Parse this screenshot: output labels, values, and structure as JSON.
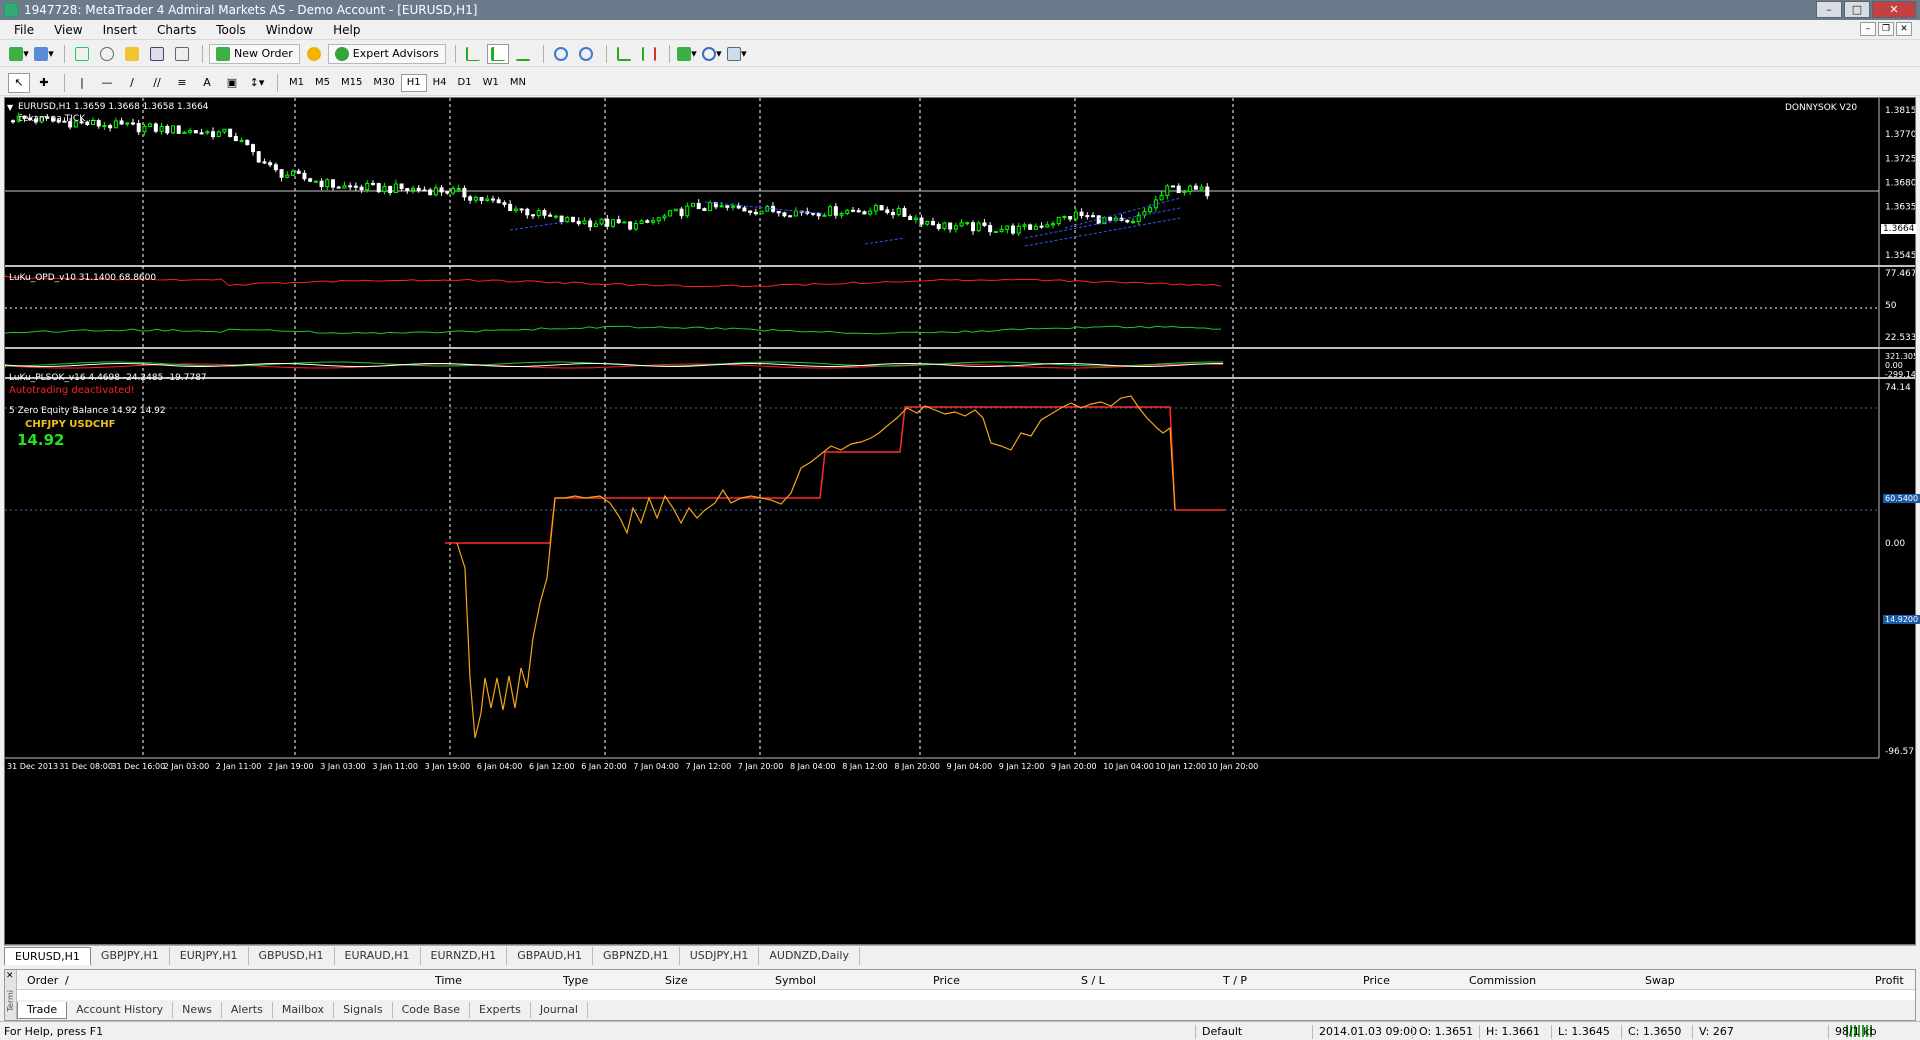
{
  "window": {
    "title": "1947728: MetaTrader 4 Admiral Markets AS - Demo Account - [EURUSD,H1]"
  },
  "menu": [
    "File",
    "View",
    "Insert",
    "Charts",
    "Tools",
    "Window",
    "Help"
  ],
  "toolbar": {
    "new_order": "New Order",
    "expert_advisors": "Expert Advisors",
    "timeframes": [
      "M1",
      "M5",
      "M15",
      "M30",
      "H1",
      "H4",
      "D1",
      "W1",
      "MN"
    ],
    "active_timeframe": "H1"
  },
  "chart": {
    "symbol_header": "EURUSD,H1  1.3659 1.3668 1.3658 1.3664",
    "status_note": "čekam na TICK ...",
    "brand": "DONNYSOK V20",
    "current_price_label": "1.3664",
    "price_ticks": [
      "1.3815",
      "1.3770",
      "1.3725",
      "1.3680",
      "1.3635",
      "1.3590",
      "1.3545"
    ],
    "osc1": {
      "header": "LuKu_OPD_v10 31.1400 68.8600",
      "ticks": [
        "77.467",
        "50",
        "22.533"
      ]
    },
    "osc2": {
      "header": "LuKu_PLSOK_v16 4.4698 -24.2485 -19.7787",
      "warning": "Autotrading deactivated!",
      "ticks": [
        "321.3054",
        "0.00",
        "-299.1495"
      ]
    },
    "equity": {
      "header": "5 Zero Equity Balance 14.92 14.92",
      "pairs_label": "CHFJPY  USDCHF",
      "big_value": "14.92",
      "ticks": [
        "74.14",
        "0.00",
        "-96.57"
      ],
      "level_labels": [
        "60.5400",
        "14.9200"
      ]
    },
    "time_labels": [
      "31 Dec 2013",
      "31 Dec 08:00",
      "31 Dec 16:00",
      "2 Jan 03:00",
      "2 Jan 11:00",
      "2 Jan 19:00",
      "3 Jan 03:00",
      "3 Jan 11:00",
      "3 Jan 19:00",
      "6 Jan 04:00",
      "6 Jan 12:00",
      "6 Jan 20:00",
      "7 Jan 04:00",
      "7 Jan 12:00",
      "7 Jan 20:00",
      "8 Jan 04:00",
      "8 Jan 12:00",
      "8 Jan 20:00",
      "9 Jan 04:00",
      "9 Jan 12:00",
      "9 Jan 20:00",
      "10 Jan 04:00",
      "10 Jan 12:00",
      "10 Jan 20:00"
    ],
    "colors": {
      "background": "#000000",
      "bull_candle": "#00ff00",
      "bear_candle": "#ffffff",
      "osc_red": "#ff2020",
      "osc_green": "#1fcc1f",
      "equity_line": "#f0a81a",
      "balance_line": "#ff2a2a",
      "big_value": "#1fe51f"
    }
  },
  "chart_tabs": [
    "EURUSD,H1",
    "GBPJPY,H1",
    "EURJPY,H1",
    "GBPUSD,H1",
    "EURAUD,H1",
    "EURNZD,H1",
    "GBPAUD,H1",
    "GBPNZD,H1",
    "USDJPY,H1",
    "AUDNZD,Daily"
  ],
  "terminal": {
    "side_label": "Termi",
    "columns": [
      "Order",
      "/",
      "Time",
      "Type",
      "Size",
      "Symbol",
      "Price",
      "S / L",
      "T / P",
      "Price",
      "Commission",
      "Swap",
      "Profit"
    ],
    "tabs": [
      "Trade",
      "Account History",
      "News",
      "Alerts",
      "Mailbox",
      "Signals",
      "Code Base",
      "Experts",
      "Journal"
    ]
  },
  "status": {
    "help": "For Help, press F1",
    "profile": "Default",
    "time": "2014.01.03 09:00",
    "open": "O: 1.3651",
    "high": "H: 1.3661",
    "low": "L: 1.3645",
    "close": "C: 1.3650",
    "volume": "V: 267",
    "traffic": "98/1 kb"
  }
}
